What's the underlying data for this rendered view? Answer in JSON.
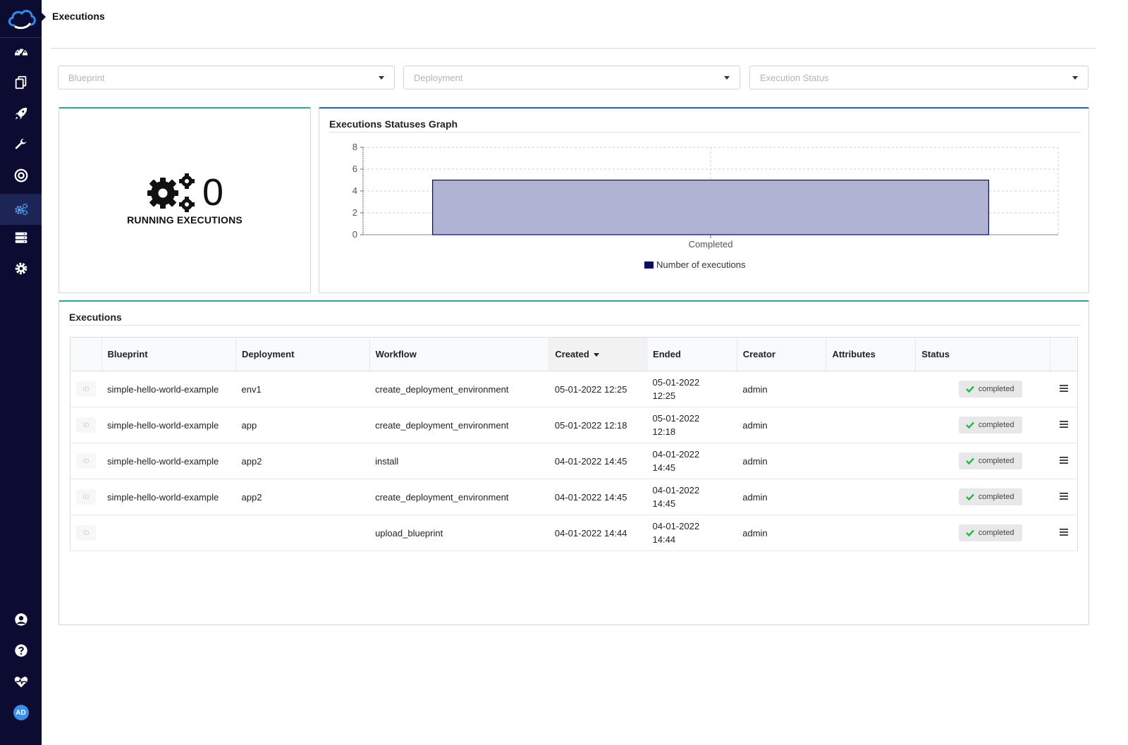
{
  "header": {
    "title": "Executions"
  },
  "filters": {
    "blueprint_placeholder": "Blueprint",
    "deployment_placeholder": "Deployment",
    "status_placeholder": "Execution Status"
  },
  "running": {
    "count": "0",
    "label": "RUNNING EXECUTIONS"
  },
  "graph": {
    "title": "Executions Statuses Graph"
  },
  "chart_data": {
    "type": "bar",
    "categories": [
      "Completed"
    ],
    "series": [
      {
        "name": "Number of executions",
        "values": [
          5
        ]
      }
    ],
    "yticks": [
      "0",
      "2",
      "4",
      "6",
      "8"
    ],
    "ylim": [
      0,
      8
    ],
    "grid": true,
    "legend": "bottom",
    "color": "#b1b3d4",
    "edge_color": "#0c0c66"
  },
  "executions": {
    "title": "Executions",
    "columns": {
      "blueprint": "Blueprint",
      "deployment": "Deployment",
      "workflow": "Workflow",
      "created": "Created",
      "ended": "Ended",
      "creator": "Creator",
      "attributes": "Attributes",
      "status": "Status"
    },
    "id_label": "ID",
    "rows": [
      {
        "blueprint": "simple-hello-world-example",
        "deployment": "env1",
        "workflow": "create_deployment_environment",
        "created": "05-01-2022 12:25",
        "ended_date": "05-01-2022",
        "ended_time": "12:25",
        "creator": "admin",
        "status": "completed"
      },
      {
        "blueprint": "simple-hello-world-example",
        "deployment": "app",
        "workflow": "create_deployment_environment",
        "created": "05-01-2022 12:18",
        "ended_date": "05-01-2022",
        "ended_time": "12:18",
        "creator": "admin",
        "status": "completed"
      },
      {
        "blueprint": "simple-hello-world-example",
        "deployment": "app2",
        "workflow": "install",
        "created": "04-01-2022 14:45",
        "ended_date": "04-01-2022",
        "ended_time": "14:45",
        "creator": "admin",
        "status": "completed"
      },
      {
        "blueprint": "simple-hello-world-example",
        "deployment": "app2",
        "workflow": "create_deployment_environment",
        "created": "04-01-2022 14:45",
        "ended_date": "04-01-2022",
        "ended_time": "14:45",
        "creator": "admin",
        "status": "completed"
      },
      {
        "blueprint": "",
        "deployment": "",
        "workflow": "upload_blueprint",
        "created": "04-01-2022 14:44",
        "ended_date": "04-01-2022",
        "ended_time": "14:44",
        "creator": "admin",
        "status": "completed"
      }
    ]
  },
  "user": {
    "initials": "AD"
  },
  "colors": {
    "sidebar": "#0c0c33",
    "accent_teal": "#29a59b",
    "accent_blue": "#1f67b5",
    "success": "#21ba45"
  },
  "icons": {
    "logo": "cloud-logo-icon",
    "nav": [
      "dashboard-icon",
      "blueprints-icon",
      "rocket-icon",
      "wrench-icon",
      "target-icon",
      "cogs-icon",
      "server-icon",
      "gear-icon"
    ],
    "bottom": [
      "user-icon",
      "help-icon",
      "heartbeat-icon",
      "avatar"
    ]
  }
}
